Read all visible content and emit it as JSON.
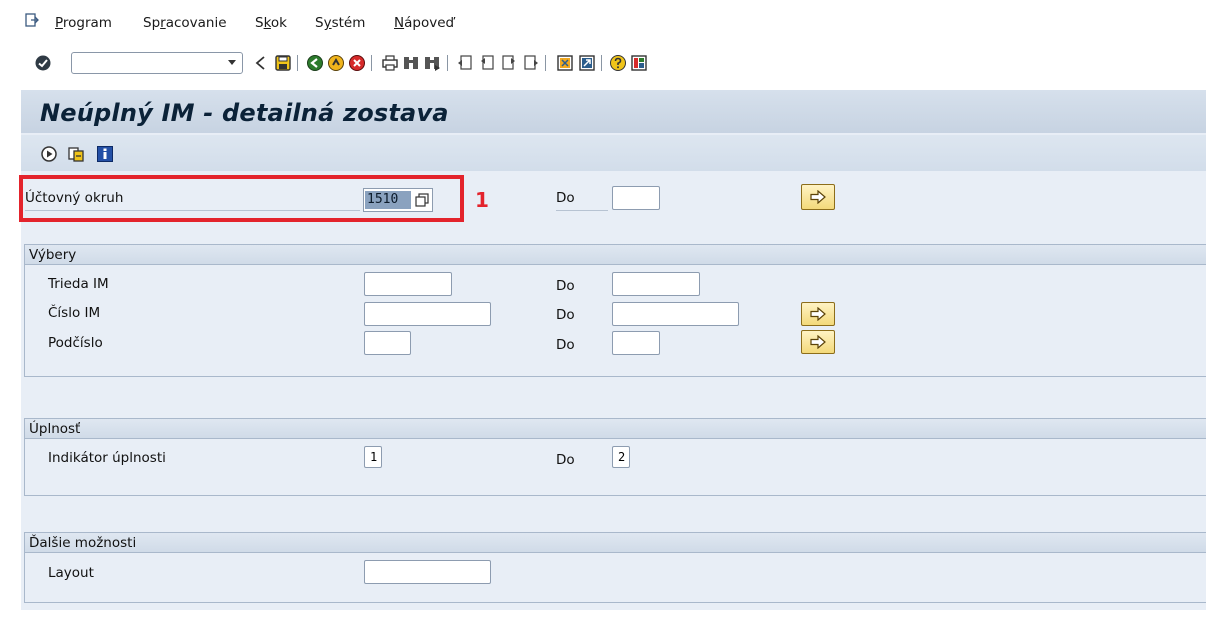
{
  "menu": {
    "items": [
      {
        "key": "P",
        "rest": "rogram"
      },
      {
        "pre": "Sp",
        "key": "r",
        "rest": "acovanie"
      },
      {
        "pre": "S",
        "key": "k",
        "rest": "ok"
      },
      {
        "pre": "S",
        "key": "y",
        "rest": "stém"
      },
      {
        "key": "N",
        "rest": "ápoveď"
      }
    ]
  },
  "toolbar": {
    "command_value": "",
    "icons": [
      "check-icon",
      "back-icon",
      "save-icon",
      "back-nav-icon",
      "exit-icon",
      "cancel-icon",
      "print-icon",
      "find-icon",
      "find-next-icon",
      "first-page-icon",
      "prev-page-icon",
      "next-page-icon",
      "last-page-icon",
      "new-session-icon",
      "shortcut-icon",
      "help-icon",
      "layout-icon"
    ]
  },
  "page": {
    "title": "Neúplný IM - detailná zostava"
  },
  "app_toolbar": {
    "icons": [
      "execute-icon",
      "variant-icon",
      "info-icon"
    ]
  },
  "company_code": {
    "label": "Účtovný okruh",
    "value": "1510",
    "to_label": "Do",
    "to_value": "",
    "annotation": "1"
  },
  "selections": {
    "title": "Výbery",
    "rows": [
      {
        "label": "Trieda IM",
        "from": "",
        "to_label": "Do",
        "to": ""
      },
      {
        "label": "Číslo IM",
        "from": "",
        "to_label": "Do",
        "to": ""
      },
      {
        "label": "Podčíslo",
        "from": "",
        "to_label": "Do",
        "to": ""
      }
    ]
  },
  "completeness": {
    "title": "Úplnosť",
    "label": "Indikátor úplnosti",
    "from": "1",
    "to_label": "Do",
    "to": "2"
  },
  "options": {
    "title": "Ďalšie možnosti",
    "layout_label": "Layout",
    "layout_value": ""
  },
  "colors": {
    "accent_red": "#e3232c",
    "panel_bg": "#e8eef6",
    "title_bg": "#c7d3e2",
    "multi_btn": "#f3d97a"
  }
}
